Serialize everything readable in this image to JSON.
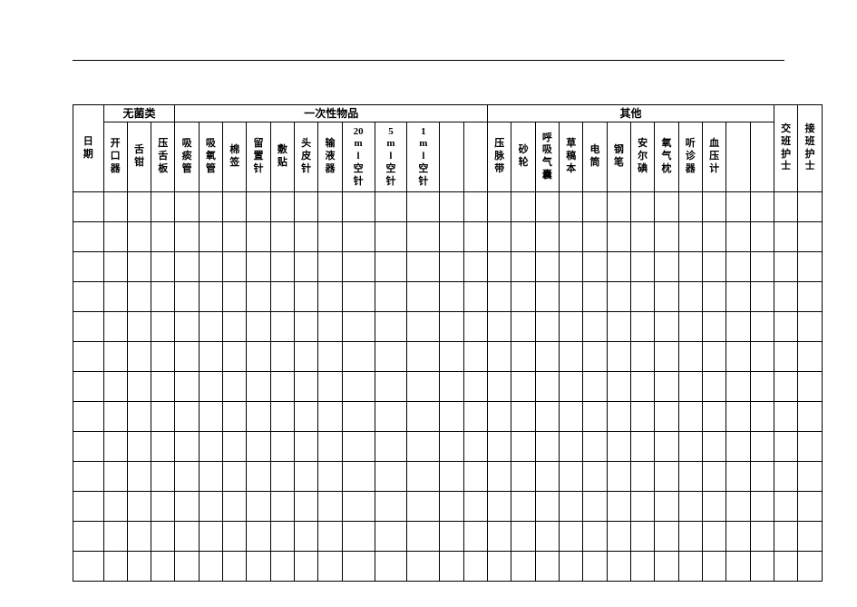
{
  "groups": {
    "g1": "无菌类",
    "g2": "一次性物品",
    "g3": "其他"
  },
  "headers": {
    "date": "日期",
    "c1": "开口器",
    "c2": "舌钳",
    "c3": "压舌板",
    "c4": "吸痰管",
    "c5": "吸氧管",
    "c6": "棉签",
    "c7": "留置针",
    "c8": "敷贴",
    "c9": "头皮针",
    "c10": "输液器",
    "c11": "20ml空针",
    "c12": "5ml空针",
    "c13": "1ml空针",
    "c14": "",
    "c15": "",
    "c16": "压脉带",
    "c17": "砂轮",
    "c18": "呼吸气囊",
    "c19": "草稿本",
    "c20": "电筒",
    "c21": "钢笔",
    "c22": "安尔碘",
    "c23": "氧气枕",
    "c24": "听诊器",
    "c25": "血压计",
    "c26": "",
    "c27": "",
    "c28": "交班护士",
    "c29": "接班护士"
  },
  "body_rows": 13
}
